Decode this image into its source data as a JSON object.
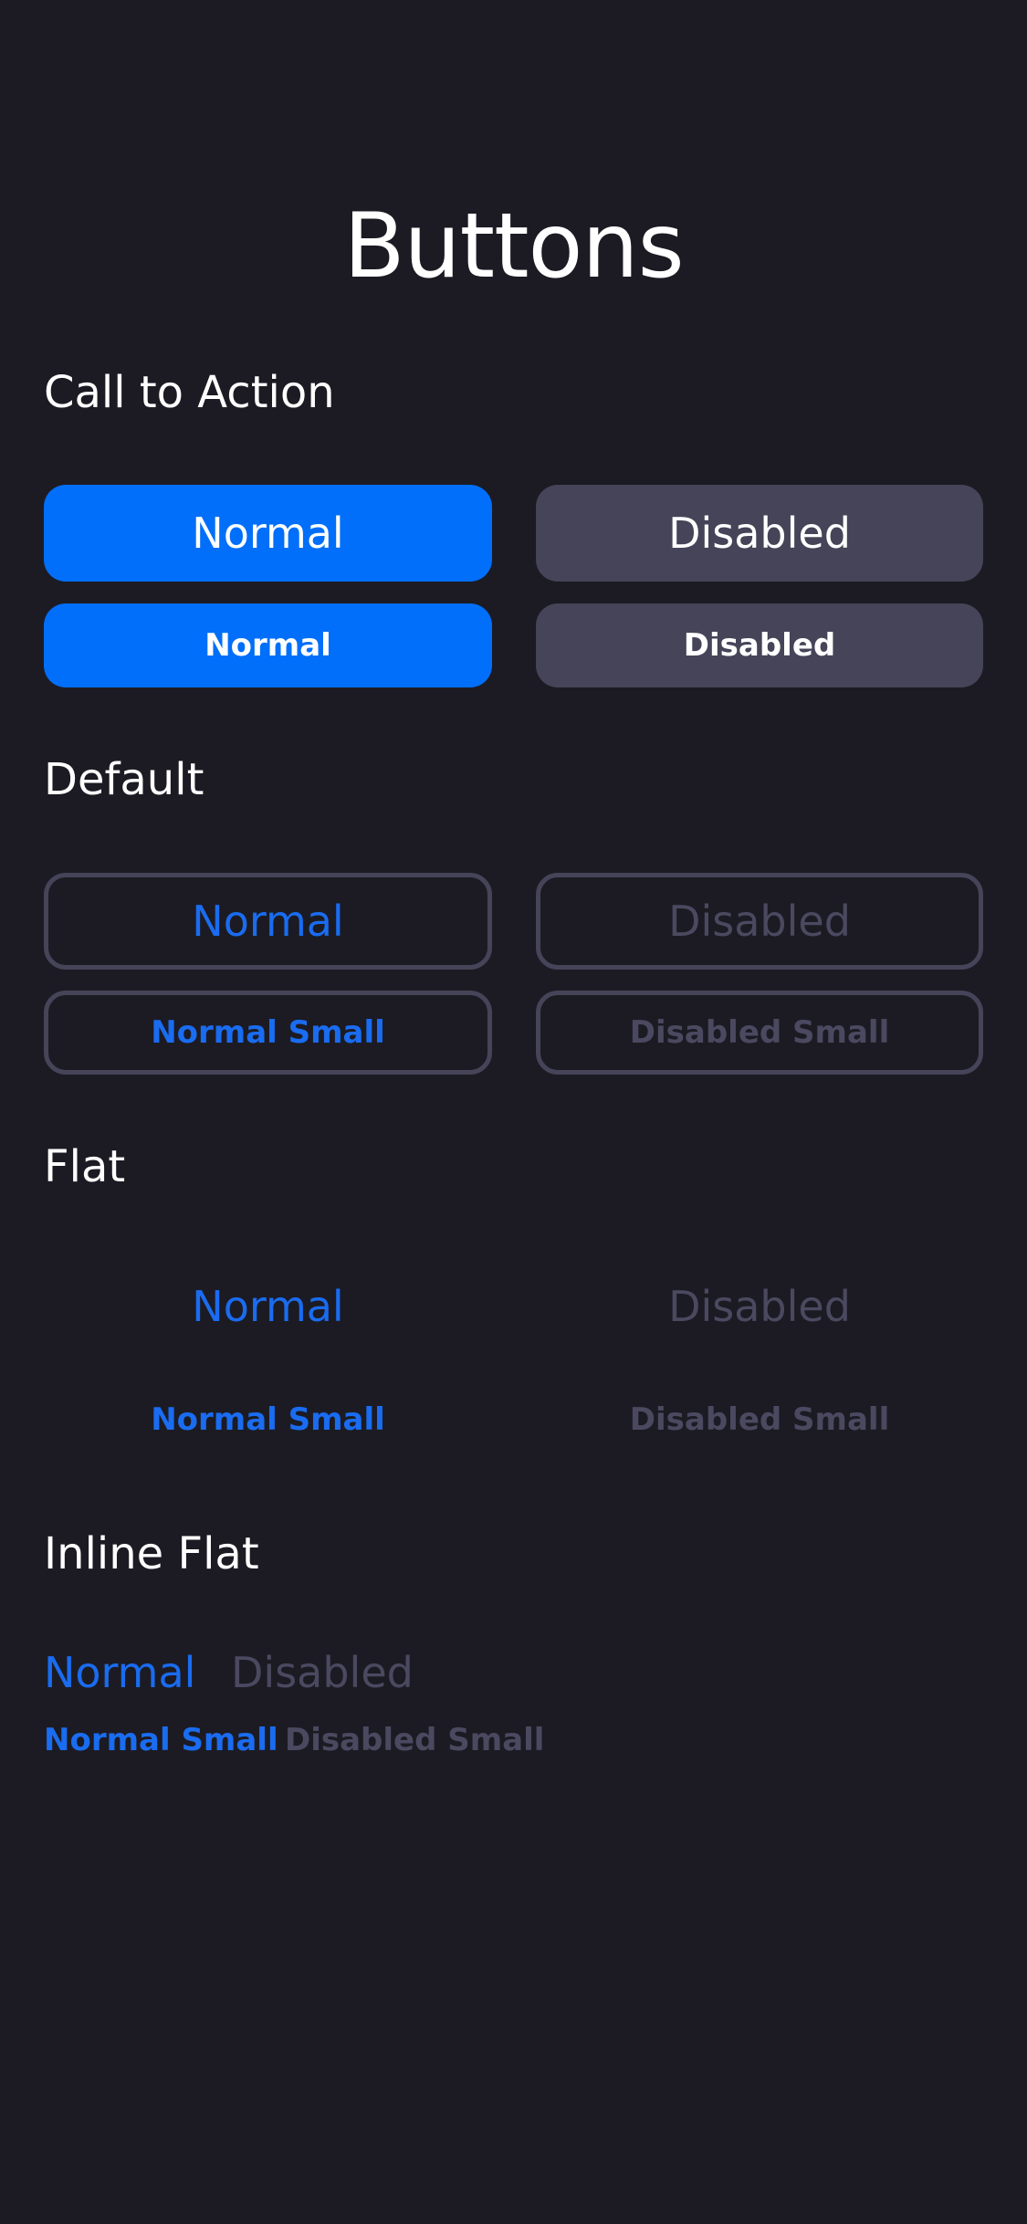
{
  "page": {
    "title": "Buttons",
    "background_color": "#1c1b23"
  },
  "colors": {
    "accent": "#016ff9",
    "link": "#1a6cf0",
    "disabled_fill": "#454458",
    "disabled_text": "#4a4960",
    "outline": "#454458"
  },
  "sections": {
    "call_to_action": {
      "title": "Call to Action",
      "normal_large": "Normal",
      "disabled_large": "Disabled",
      "normal_small": "Normal",
      "disabled_small": "Disabled"
    },
    "default": {
      "title": "Default",
      "normal_large": "Normal",
      "disabled_large": "Disabled",
      "normal_small": "Normal Small",
      "disabled_small": "Disabled Small"
    },
    "flat": {
      "title": "Flat",
      "normal_large": "Normal",
      "disabled_large": "Disabled",
      "normal_small": "Normal Small",
      "disabled_small": "Disabled Small"
    },
    "inline_flat": {
      "title": "Inline Flat",
      "normal_large": "Normal",
      "disabled_large": "Disabled",
      "normal_small": "Normal Small",
      "disabled_small": "Disabled Small"
    }
  }
}
